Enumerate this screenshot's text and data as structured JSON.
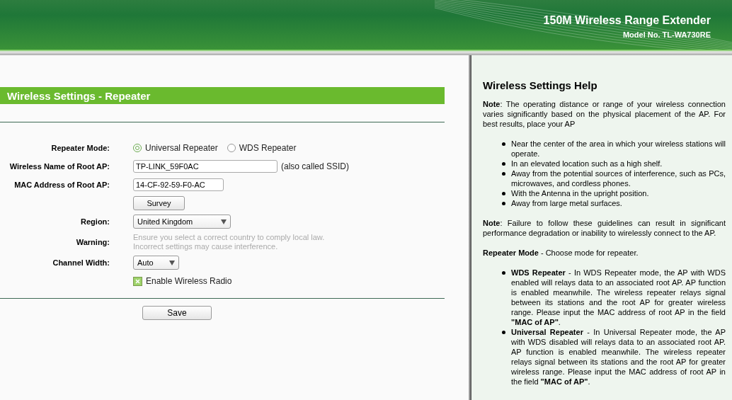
{
  "header": {
    "title": "150M Wireless Range Extender",
    "model": "Model No. TL-WA730RE"
  },
  "form": {
    "title": "Wireless Settings - Repeater",
    "fields": [
      {
        "kind": "radio",
        "label": "Repeater Mode:",
        "options": [
          {
            "label": "Universal Repeater",
            "selected": true
          },
          {
            "label": "WDS Repeater",
            "selected": false
          }
        ]
      },
      {
        "kind": "text",
        "label": "Wireless Name of Root AP:",
        "value": "TP-LINK_59F0AC",
        "suffix": "(also called SSID)"
      },
      {
        "kind": "text",
        "label": "MAC Address of Root AP:",
        "value": "14-CF-92-59-F0-AC"
      },
      {
        "kind": "button",
        "text": "Survey"
      },
      {
        "kind": "select",
        "label": "Region:",
        "value": "United Kingdom"
      },
      {
        "kind": "note",
        "label": "Warning:",
        "lines": [
          "Ensure you select a correct country to comply local law.",
          "Incorrect settings may cause interference."
        ]
      },
      {
        "kind": "select",
        "label": "Channel Width:",
        "value": "Auto"
      },
      {
        "kind": "checkbox",
        "text": "Enable Wireless Radio",
        "checked": true
      }
    ],
    "save": "Save"
  },
  "help": {
    "title": "Wireless Settings Help",
    "blocks": [
      {
        "kind": "paragraph",
        "text": "**Note**: The operating distance or range of your wireless connection varies significantly based on the physical placement of the AP. For best results, place your AP"
      },
      {
        "kind": "list",
        "items": [
          "Near the center of the area in which your wireless stations will operate.",
          "In an elevated location such as a high shelf.",
          "Away from the potential sources of interference, such as PCs, microwaves, and cordless phones.",
          "With the Antenna in the upright position.",
          "Away from large metal surfaces."
        ]
      },
      {
        "kind": "paragraph",
        "text": "**Note**: Failure to follow these guidelines can result in significant performance degradation or inability to wirelessly connect to the AP."
      },
      {
        "kind": "paragraph",
        "text": "**Repeater Mode** - Choose mode for repeater."
      },
      {
        "kind": "list",
        "items": [
          "**WDS Repeater** - In WDS Repeater mode, the AP with WDS enabled will relays data to an associated root AP. AP function is enabled meanwhile. The wireless repeater relays signal between its stations and the root AP for greater wireless range. Please input the MAC address of root AP in the field **\"MAC of AP\"**.",
          "**Universal Repeater** - In Universal Repeater mode, the AP with WDS disabled will relays data to an associated root AP. AP function is enabled meanwhile. The wireless repeater relays signal between its stations and the root AP for greater wireless range. Please input the MAC address of root AP in the field **\"MAC of AP\"**."
        ]
      }
    ]
  }
}
